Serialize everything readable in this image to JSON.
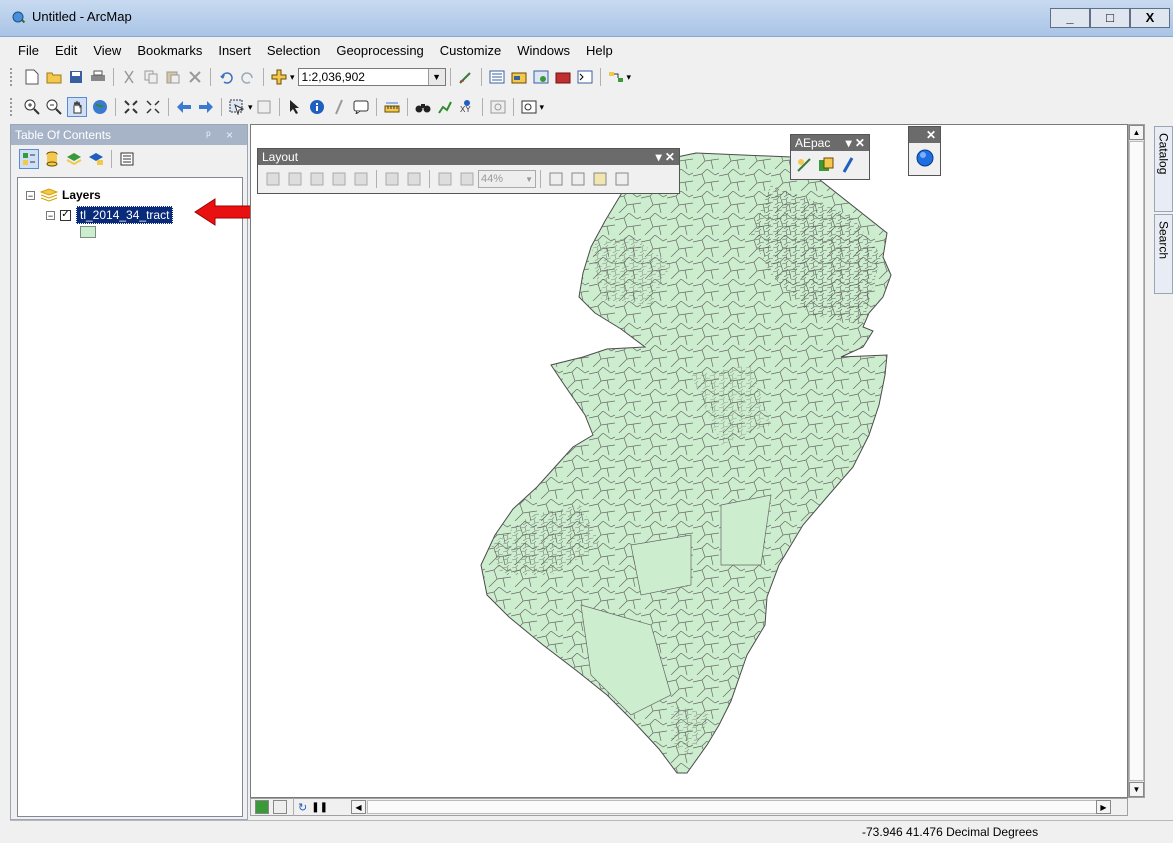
{
  "window": {
    "title": "Untitled - ArcMap",
    "controls": {
      "minimize": "_",
      "maximize": "□",
      "close": "X"
    }
  },
  "menu": [
    "File",
    "Edit",
    "View",
    "Bookmarks",
    "Insert",
    "Selection",
    "Geoprocessing",
    "Customize",
    "Windows",
    "Help"
  ],
  "standard_toolbar": {
    "scale": "1:2,036,902",
    "icons": [
      "new-document-icon",
      "open-folder-icon",
      "save-icon",
      "print-icon",
      "cut-icon",
      "copy-icon",
      "paste-icon",
      "delete-icon",
      "undo-icon",
      "redo-icon",
      "add-data-icon"
    ]
  },
  "tools_toolbar": {
    "icons": [
      "zoom-in-icon",
      "zoom-out-icon",
      "pan-icon",
      "full-extent-icon",
      "fixed-zoom-in-icon",
      "fixed-zoom-out-icon",
      "back-icon",
      "forward-icon",
      "select-features-icon",
      "clear-selection-icon",
      "select-elements-icon",
      "identify-icon",
      "hyperlink-icon",
      "html-popup-icon",
      "measure-icon",
      "find-icon",
      "find-route-icon",
      "goto-xy-icon",
      "time-slider-icon",
      "create-viewer-icon"
    ]
  },
  "toc": {
    "title": "Table Of Contents",
    "header_controls": "ᵖ ×",
    "root_label": "Layers",
    "layer_name": "tl_2014_34_tract",
    "layer_checked": true,
    "symbol_color": "#cdeece"
  },
  "layout_toolbar": {
    "title": "Layout",
    "zoom_percent": "44%"
  },
  "aepac_toolbar": {
    "title": "AEpac"
  },
  "dock_tabs": {
    "catalog": "Catalog",
    "search": "Search"
  },
  "status": {
    "coordinates": "-73.946  41.476 Decimal Degrees"
  },
  "colors": {
    "map_fill": "#cdeece",
    "tract_lines": "#555555",
    "selection": "#0a2a7a",
    "annotation_arrow": "#e81010"
  }
}
